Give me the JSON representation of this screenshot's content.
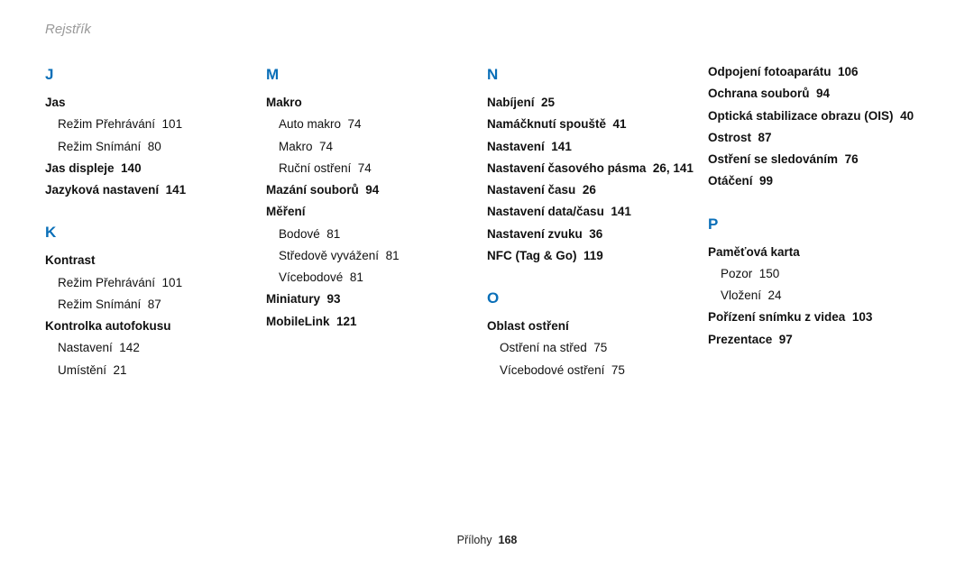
{
  "header": "Rejstřík",
  "footer": {
    "label": "Přílohy",
    "page": "168"
  },
  "columns": [
    {
      "letters": [
        {
          "letter": "J",
          "groups": [
            {
              "term": "Jas",
              "subs": [
                {
                  "text": "Režim Přehrávání",
                  "page": "101"
                },
                {
                  "text": "Režim Snímání",
                  "page": "80"
                }
              ]
            },
            {
              "term": "Jas displeje",
              "page": "140"
            },
            {
              "term": "Jazyková nastavení",
              "page": "141"
            }
          ]
        },
        {
          "letter": "K",
          "groups": [
            {
              "term": "Kontrast",
              "subs": [
                {
                  "text": "Režim Přehrávání",
                  "page": "101"
                },
                {
                  "text": "Režim Snímání",
                  "page": "87"
                }
              ]
            },
            {
              "term": "Kontrolka autofokusu",
              "subs": [
                {
                  "text": "Nastavení",
                  "page": "142"
                },
                {
                  "text": "Umístění",
                  "page": "21"
                }
              ]
            }
          ]
        }
      ]
    },
    {
      "letters": [
        {
          "letter": "M",
          "groups": [
            {
              "term": "Makro",
              "subs": [
                {
                  "text": "Auto makro",
                  "page": "74"
                },
                {
                  "text": "Makro",
                  "page": "74"
                },
                {
                  "text": "Ruční ostření",
                  "page": "74"
                }
              ]
            },
            {
              "term": "Mazání souborů",
              "page": "94"
            },
            {
              "term": "Měření",
              "subs": [
                {
                  "text": "Bodové",
                  "page": "81"
                },
                {
                  "text": "Středově vyvážení",
                  "page": "81"
                },
                {
                  "text": "Vícebodové",
                  "page": "81"
                }
              ]
            },
            {
              "term": "Miniatury",
              "page": "93"
            },
            {
              "term": "MobileLink",
              "page": "121"
            }
          ]
        }
      ]
    },
    {
      "letters": [
        {
          "letter": "N",
          "groups": [
            {
              "term": "Nabíjení",
              "page": "25"
            },
            {
              "term": "Namáčknutí spouště",
              "page": "41"
            },
            {
              "term": "Nastavení",
              "page": "141"
            },
            {
              "term": "Nastavení časového pásma",
              "page": "26, 141"
            },
            {
              "term": "Nastavení času",
              "page": "26"
            },
            {
              "term": "Nastavení data/času",
              "page": "141"
            },
            {
              "term": "Nastavení zvuku",
              "page": "36"
            },
            {
              "term": "NFC (Tag & Go)",
              "page": "119"
            }
          ]
        },
        {
          "letter": "O",
          "groups": [
            {
              "term": "Oblast ostření",
              "subs": [
                {
                  "text": "Ostření na střed",
                  "page": "75"
                },
                {
                  "text": "Vícebodové ostření",
                  "page": "75"
                }
              ]
            }
          ]
        }
      ]
    },
    {
      "letters": [
        {
          "letter": "",
          "groups": [
            {
              "term": "Odpojení fotoaparátu",
              "page": "106"
            },
            {
              "term": "Ochrana souborů",
              "page": "94"
            },
            {
              "term": "Optická stabilizace obrazu (OIS)",
              "page": "40"
            },
            {
              "term": "Ostrost",
              "page": "87"
            },
            {
              "term": "Ostření se sledováním",
              "page": "76"
            },
            {
              "term": "Otáčení",
              "page": "99"
            }
          ]
        },
        {
          "letter": "P",
          "groups": [
            {
              "term": "Paměťová karta",
              "subs": [
                {
                  "text": "Pozor",
                  "page": "150"
                },
                {
                  "text": "Vložení",
                  "page": "24"
                }
              ]
            },
            {
              "term": "Pořízení snímku z videa",
              "page": "103"
            },
            {
              "term": "Prezentace",
              "page": "97"
            }
          ]
        }
      ]
    }
  ]
}
